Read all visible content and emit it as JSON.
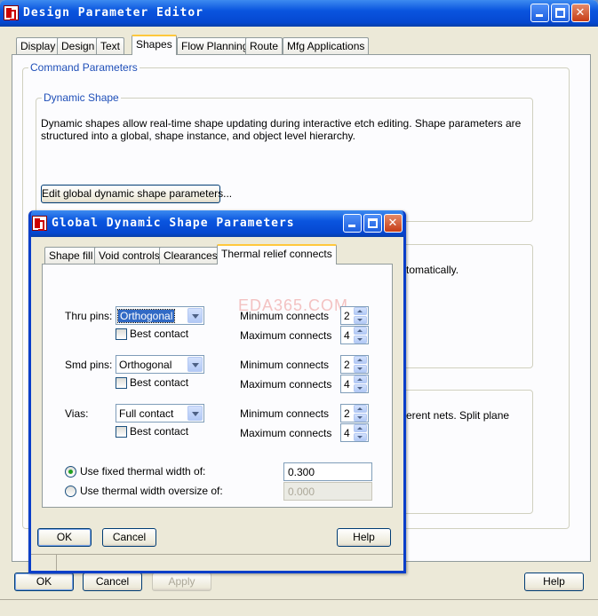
{
  "main_window": {
    "title": "Design Parameter Editor",
    "tabs": [
      "Display",
      "Design",
      "Text",
      "Shapes",
      "Flow Planning",
      "Route",
      "Mfg Applications"
    ],
    "active_tab": "Shapes",
    "command_parameters_label": "Command Parameters",
    "dynamic_shape_group_label": "Dynamic Shape",
    "dynamic_shape_desc_line1": "Dynamic shapes allow real-time shape updating during interactive etch editing.  Shape parameters are",
    "dynamic_shape_desc_line2": "structured into a global, shape instance, and object level hierarchy.",
    "edit_global_button": "Edit global dynamic shape parameters...",
    "hidden_text_1": "tomatically.",
    "hidden_text_2": "erent nets.  Split plane",
    "buttons": {
      "ok": "OK",
      "cancel": "Cancel",
      "apply": "Apply",
      "help": "Help"
    }
  },
  "dialog": {
    "title": "Global Dynamic Shape Parameters",
    "tabs": [
      "Shape fill",
      "Void controls",
      "Clearances",
      "Thermal relief connects"
    ],
    "active_tab": "Thermal relief connects",
    "rows": [
      {
        "label": "Thru pins:",
        "value": "Orthogonal",
        "best_contact": "Best contact",
        "min_label": "Minimum connects",
        "min_value": "2",
        "max_label": "Maximum connects",
        "max_value": "4"
      },
      {
        "label": "Smd pins:",
        "value": "Orthogonal",
        "best_contact": "Best contact",
        "min_label": "Minimum connects",
        "min_value": "2",
        "max_label": "Maximum connects",
        "max_value": "4"
      },
      {
        "label": "Vias:",
        "value": "Full contact",
        "best_contact": "Best contact",
        "min_label": "Minimum connects",
        "min_value": "2",
        "max_label": "Maximum connects",
        "max_value": "4"
      }
    ],
    "fixed_width_label": "Use fixed thermal width of:",
    "fixed_width_value": "0.300",
    "oversize_label": "Use thermal width oversize of:",
    "oversize_value": "0.000",
    "buttons": {
      "ok": "OK",
      "cancel": "Cancel",
      "help": "Help"
    }
  },
  "watermark": "EDA365.COM",
  "colors": {
    "title_blue": "#0a55df",
    "group_label": "#1f4fb8",
    "face": "#ece9d8",
    "close_red": "#c73d16"
  }
}
